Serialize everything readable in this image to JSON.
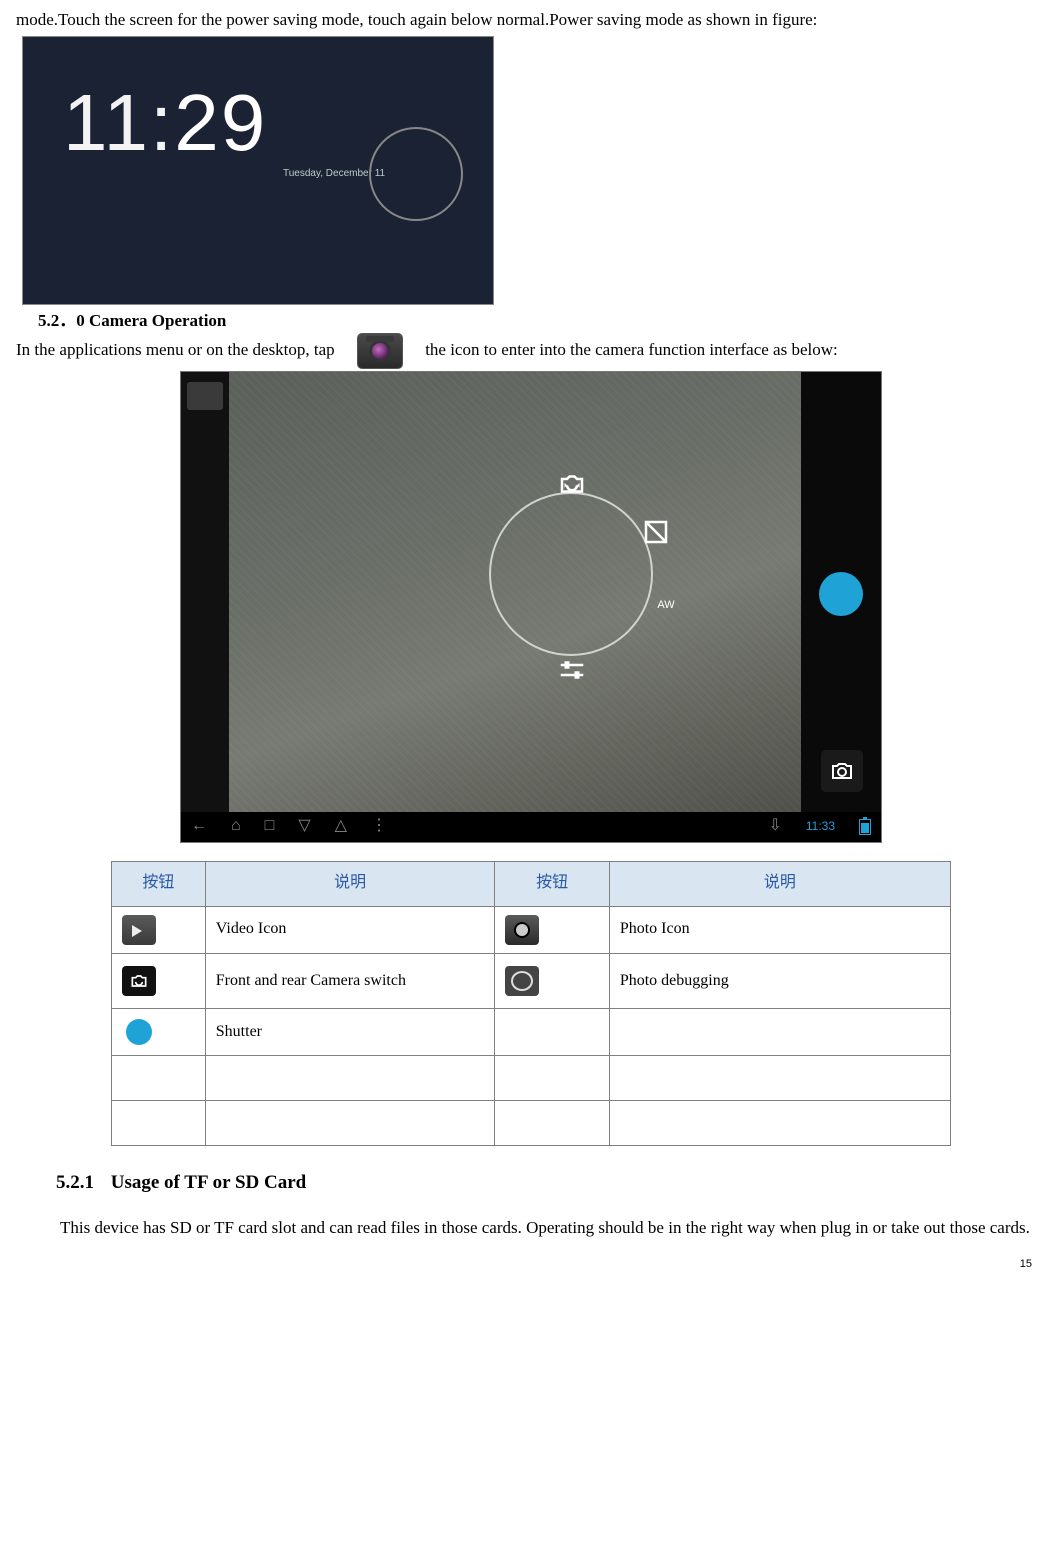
{
  "intro": "mode.Touch the screen for the power saving mode, touch again below normal.Power saving mode as shown in figure:",
  "lock": {
    "time": "11:29",
    "sub": "Tuesday, December 11"
  },
  "heading520": "5.2．0    Camera Operation",
  "camera_para_1": "In the applications menu or on the desktop, tap",
  "camera_para_2": "the    icon  to  enter  into  the  camera  function interface as below:",
  "cam": {
    "aw": "AW",
    "time": "11:33"
  },
  "legend": {
    "h1": "按钮",
    "h2": "说明",
    "h3": "按钮",
    "h4": "说明",
    "r1d1": "Video Icon",
    "r1d2": "Photo Icon",
    "r2d1": "Front  and  rear  Camera switch",
    "r2d2": "Photo debugging",
    "r3d1": "Shutter",
    "r3d2": "",
    "r4d1": "",
    "r4d2": "",
    "r5d1": "",
    "r5d2": ""
  },
  "sec521_num": "5.2.1",
  "sec521_title": "Usage of TF or SD Card",
  "sec521_para": "This device has SD or TF card slot and can read files in those cards. Operating should be in the right way when plug in or take out those cards.",
  "page_number": "15"
}
